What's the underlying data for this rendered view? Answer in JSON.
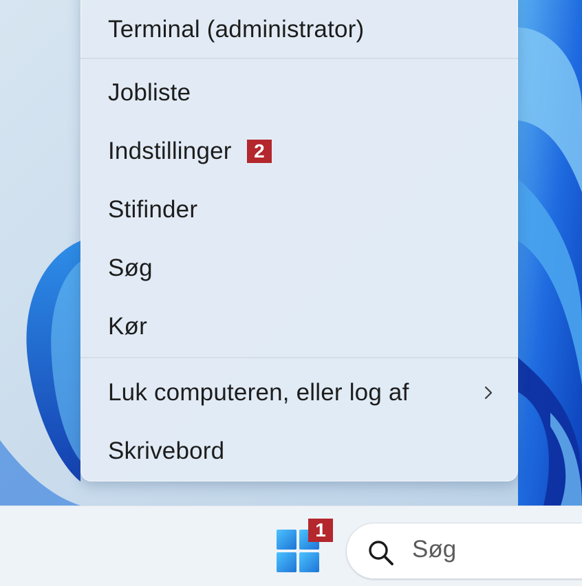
{
  "menu": {
    "items": [
      {
        "label": "Terminal (administrator)"
      },
      {
        "label": "Jobliste"
      },
      {
        "label": "Indstillinger",
        "badge": "2"
      },
      {
        "label": "Stifinder"
      },
      {
        "label": "Søg"
      },
      {
        "label": "Kør"
      },
      {
        "label": "Luk computeren, eller log af",
        "submenu": true
      },
      {
        "label": "Skrivebord"
      }
    ]
  },
  "taskbar": {
    "start_badge": "1",
    "search_placeholder": "Søg"
  },
  "colors": {
    "badge": "#b3272d",
    "start_icon": "#2f93e0",
    "wallpaper_accent": "#1a5fd6"
  },
  "icons": {
    "start": "windows-logo-icon",
    "search": "search-icon",
    "submenu": "chevron-right-icon"
  }
}
